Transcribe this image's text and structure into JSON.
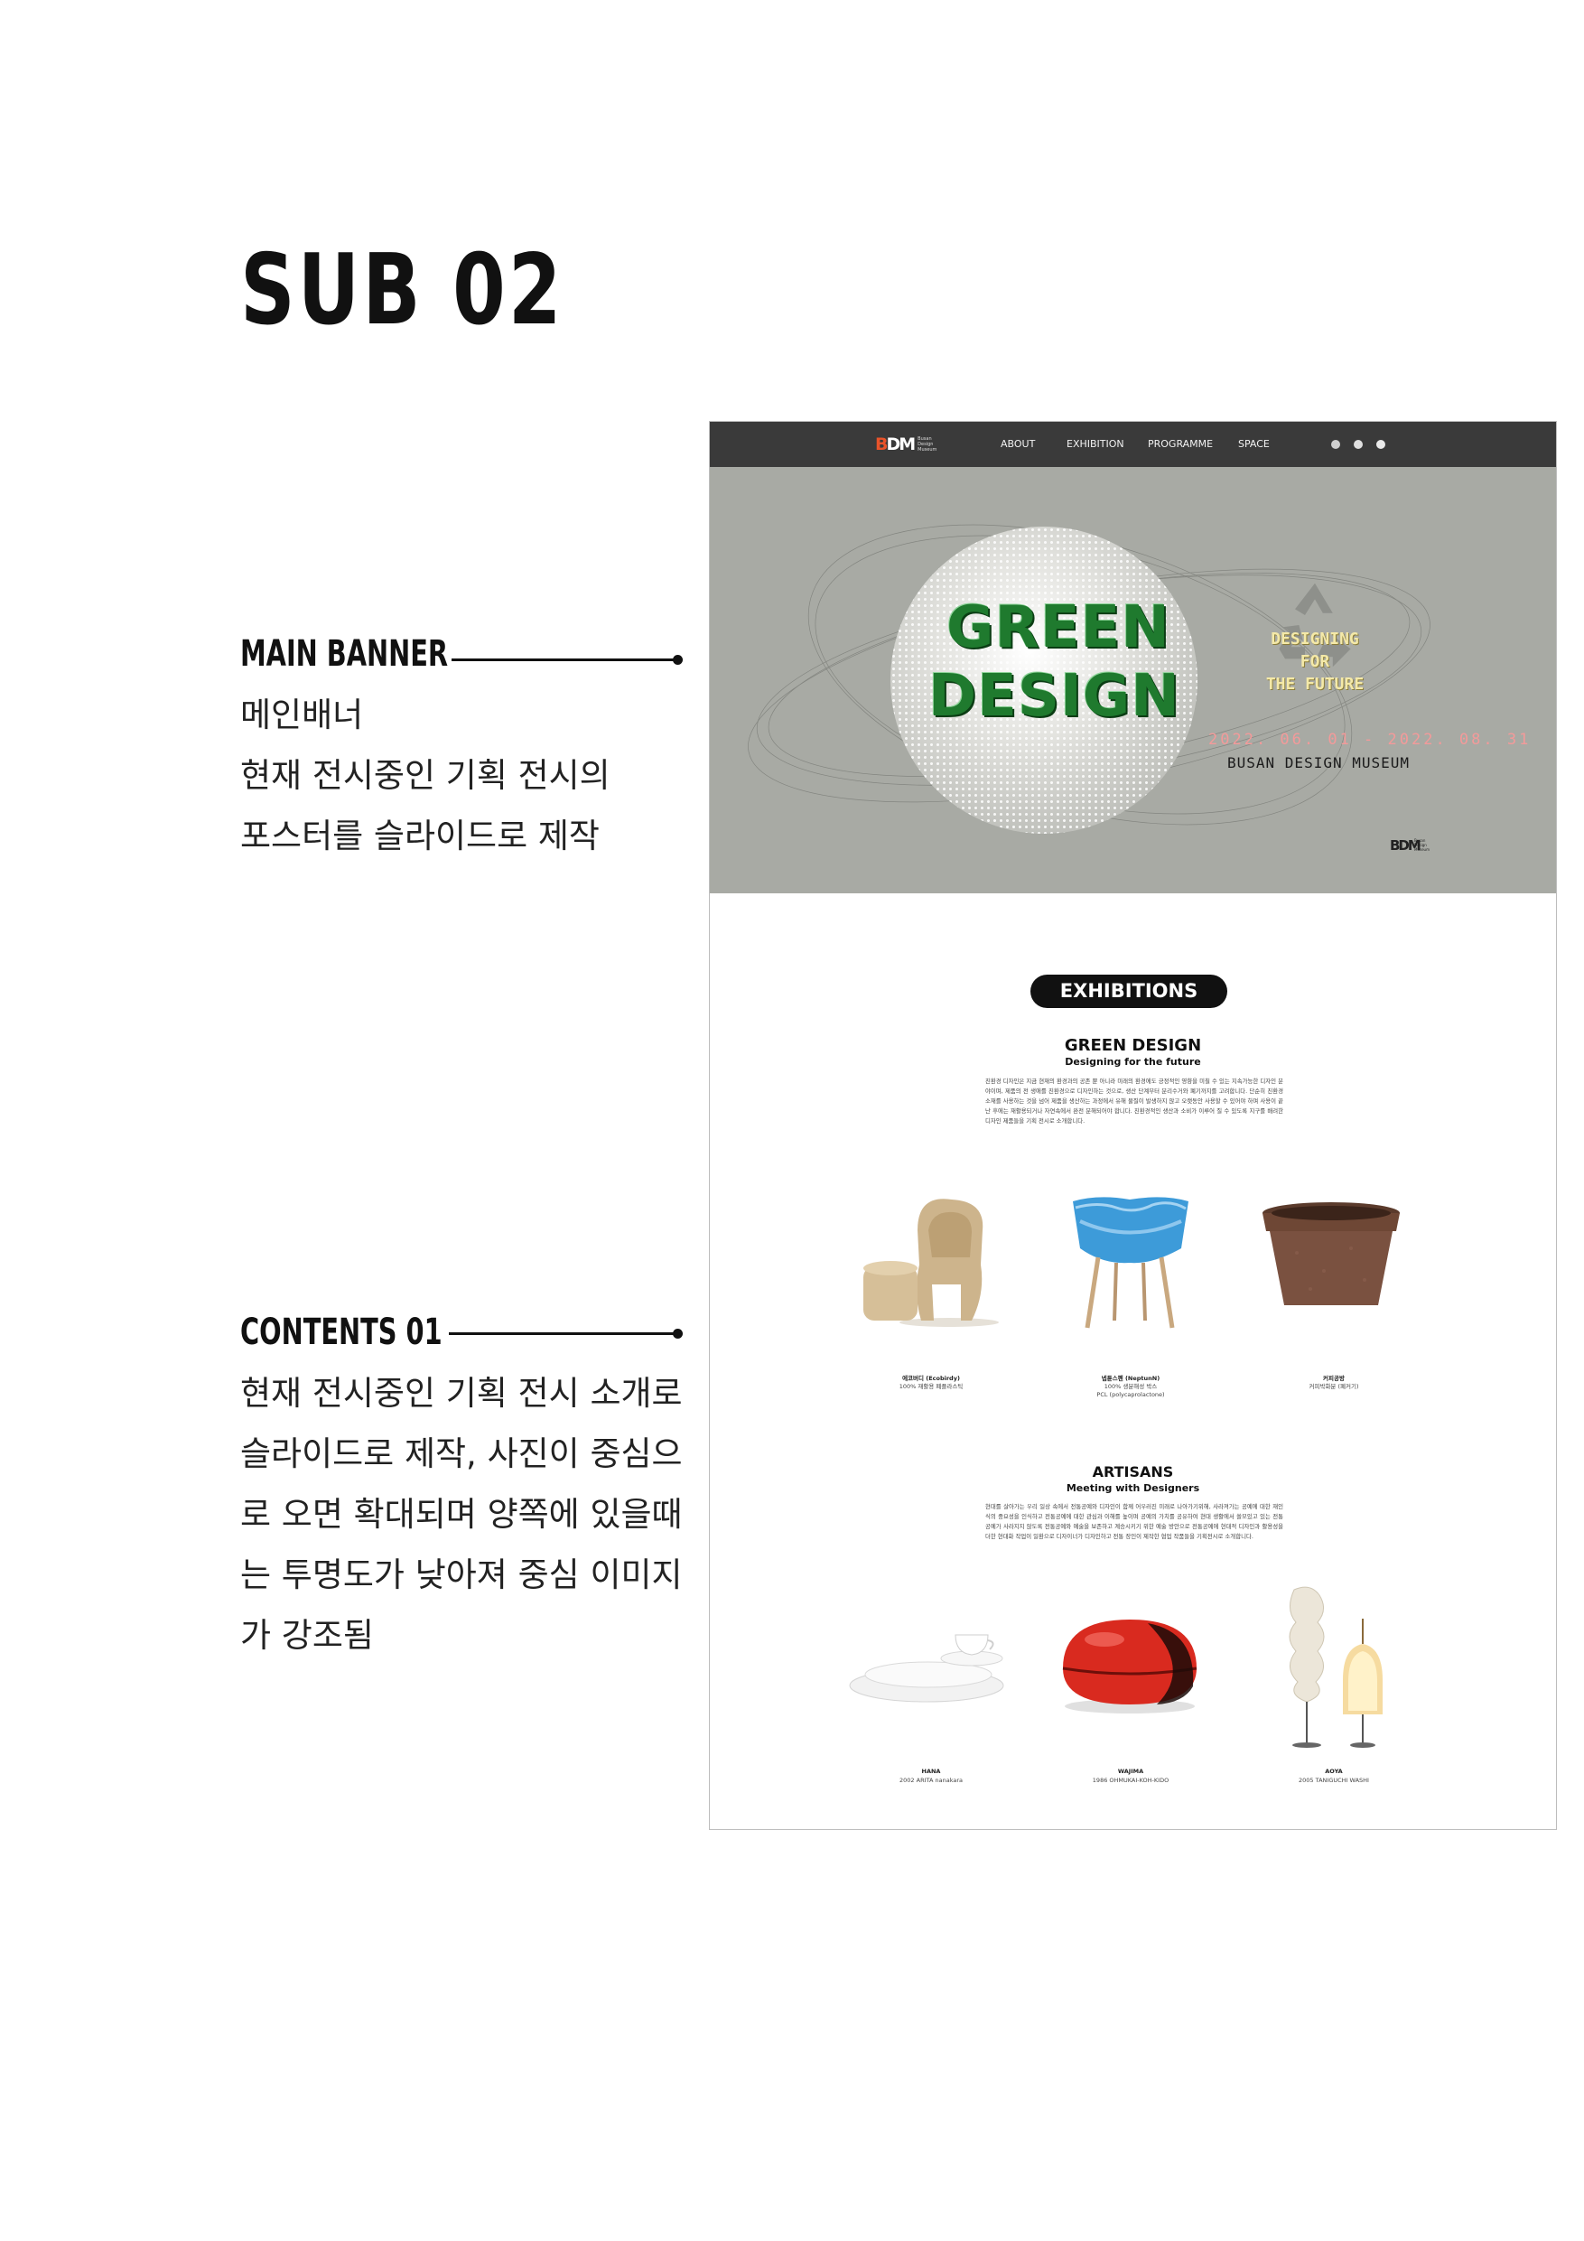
{
  "page": {
    "title": "SUB 02"
  },
  "annotations": [
    {
      "title": "MAIN BANNER",
      "lines": [
        "메인배너",
        "현재 전시중인 기획 전시의",
        "포스터를 슬라이드로 제작"
      ]
    },
    {
      "title": "CONTENTS 01",
      "lines": [
        "현재 전시중인 기획 전시 소개로",
        "슬라이드로 제작, 사진이 중심으",
        "로 오면 확대되며 양쪽에 있을때",
        "는 투명도가 낮아져 중심 이미지",
        "가 강조됨"
      ]
    }
  ],
  "mockup": {
    "nav": {
      "logo_text": [
        "Busan",
        "Design",
        "Museum"
      ],
      "items": [
        "ABOUT",
        "EXHIBITION",
        "PROGRAMME",
        "SPACE"
      ],
      "icons": [
        "globe-icon",
        "circle-icon",
        "user-icon"
      ]
    },
    "banner": {
      "headline_1": "GREEN",
      "headline_2": "DESIGN",
      "tagline": [
        "DESIGNING",
        "FOR",
        "THE FUTURE"
      ],
      "dates": "2022. 06. 01 - 2022. 08. 31",
      "venue": "BUSAN DESIGN MUSEUM",
      "colors": {
        "background": "#a8aaa4",
        "headline": "#1f7a2e",
        "tagline": "#f4e9a8",
        "dates": "#f39a9a"
      }
    },
    "exhibitions": {
      "pill": "EXHIBITIONS",
      "title": "GREEN DESIGN",
      "subtitle": "Designing for the future",
      "body": "친환경 디자인은 지금 현재의 환경과의 공존 뿐 아니라 미래의 환경에도 긍정적인 영향을 미칠 수 있는 지속가능한 디자인 분야이며, 제품의 전 생애를 친환경으로 디자인하는 것으로, 생산 단계부터 분리수거와 폐기까지를 고려합니다. 단순히 친환경 소재를 사용하는 것을 넘어 제품을 생산하는 과정에서 유해 물질이 발생하지 않고 오랫동안 사용할 수 있어야 하며 사용이 끝난 후에는 재활용되거나 자연속에서 완전 분해되어야 합니다. 친환경적인 생산과 소비가 이루어 질 수 있도록 지구를 배려한 디자인 제품들을 기획 전시로 소개합니다.",
      "items": [
        {
          "name": "에코버디 (Ecobirdy)",
          "desc": "100% 재활용 폐플라스틱"
        },
        {
          "name": "넵튠스펜 (NeptunN)",
          "desc": "100% 생분해성 박스\nPCL (polycaprolactone)"
        },
        {
          "name": "커피공방",
          "desc": "커피박화분 (폐커기)"
        }
      ]
    },
    "artisans": {
      "title": "ARTISANS",
      "subtitle": "Meeting with Designers",
      "body": "현대를 살아가는 우리 일상 속에서 전통공예와 디자인이 함께 어우러진 미래로 나아가기위해, 사라져가는 공예에 대한 재인식의 중요성을 인식하고 전통공예에 대한 관심과 이해를 높이며 공예의 가치를 공유하여 현대 생활에서 쓸모있고 있는 전통공예가 사라지지 않도록 전통공예와 예술을 보존하고 계승시키기 위한 예술 방안으로 전통공예에 현대적 디자인과 활용성을 더한 현대화 작업이 일환으로 디자이너가 디자인하고 전통 장인이 제작한 협업 작품들을 기획전시로 소개합니다.",
      "items": [
        {
          "name": "HANA",
          "desc": "2002 ARITA nanakara"
        },
        {
          "name": "WAJIMA",
          "desc": "1986 OHMUKAI-KOH-KIDO"
        },
        {
          "name": "AOYA",
          "desc": "2005 TANIGUCHI WASHI"
        }
      ]
    }
  }
}
